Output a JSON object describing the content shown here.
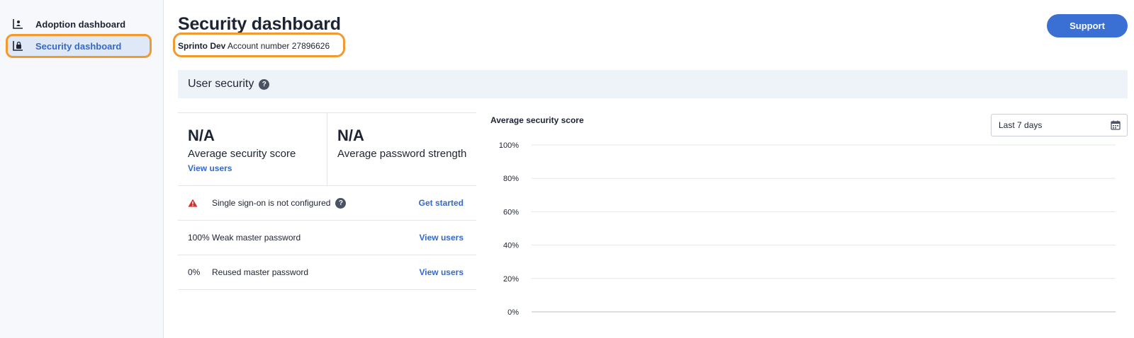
{
  "sidebar": {
    "items": [
      {
        "label": "Adoption dashboard",
        "icon": "bar-chart-person-icon",
        "active": false
      },
      {
        "label": "Security dashboard",
        "icon": "lock-chart-icon",
        "active": true
      }
    ]
  },
  "header": {
    "title": "Security dashboard",
    "org_name": "Sprinto Dev",
    "account_label": "Account number 27896626",
    "support_label": "Support"
  },
  "section": {
    "title": "User security",
    "help_icon": "?"
  },
  "stats": [
    {
      "value": "N/A",
      "label": "Average security score",
      "link": "View users"
    },
    {
      "value": "N/A",
      "label": "Average password strength"
    }
  ],
  "issues": [
    {
      "lead": "",
      "icon": "warning-icon",
      "text": "Single sign-on is not configured",
      "has_help": true,
      "help": "?",
      "action": "Get started"
    },
    {
      "lead": "100%",
      "text": "Weak master password",
      "action": "View users"
    },
    {
      "lead": "0%",
      "text": "Reused master password",
      "action": "View users"
    }
  ],
  "date_range": {
    "selected": "Last 7 days",
    "icon": "calendar-icon"
  },
  "colors": {
    "accent": "#3a6fd4",
    "highlight": "#f29a2e",
    "warning": "#d62d2d",
    "section_bg": "#eef2f9"
  },
  "chart_data": {
    "type": "line",
    "title": "Average security score",
    "yticks": [
      "100%",
      "80%",
      "60%",
      "40%",
      "20%",
      "0%"
    ],
    "ylim": [
      0,
      100
    ],
    "series": [],
    "grid": true
  }
}
